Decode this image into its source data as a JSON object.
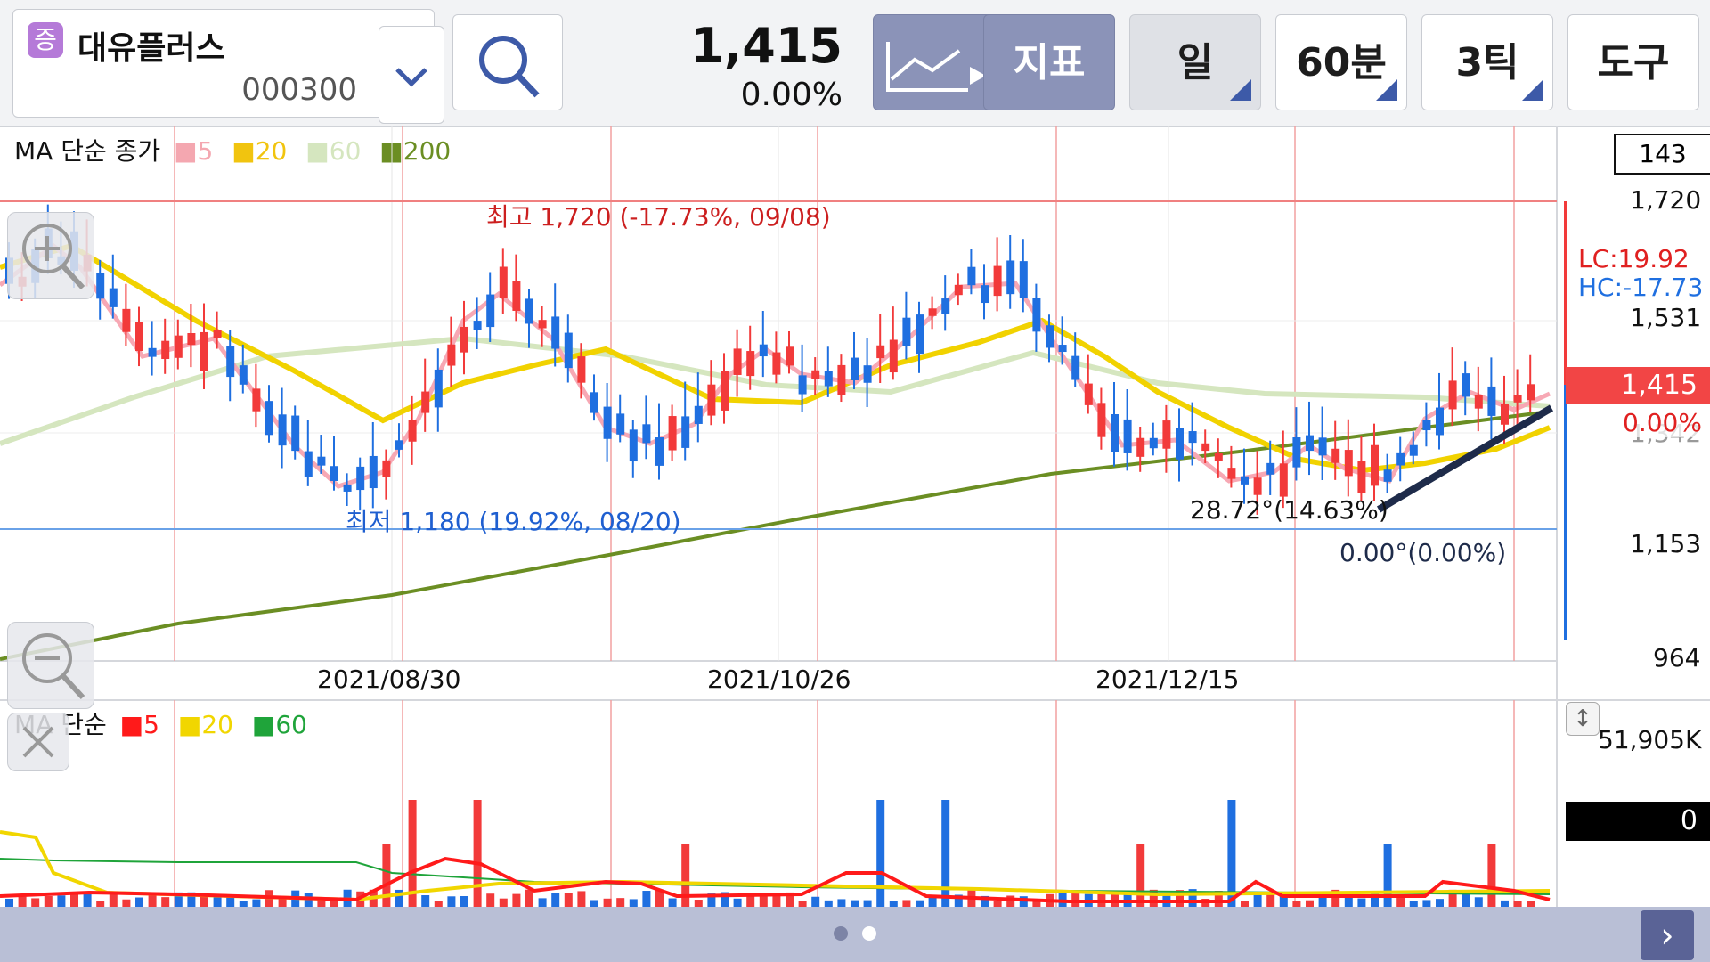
{
  "header": {
    "badge": "증",
    "stock_name": "대유플러스",
    "stock_code": "000300",
    "price": "1,415",
    "change_pct": "0.00%",
    "buttons": {
      "indicator": "지표",
      "daily": "일",
      "min60": "60분",
      "tick3": "3틱",
      "tools": "도구"
    }
  },
  "price_chart": {
    "legend_title": "MA 단순 종가",
    "ma": [
      {
        "label": "5",
        "color": "#f4a7b0"
      },
      {
        "label": "20",
        "color": "#f1c40f"
      },
      {
        "label": "60",
        "color": "#d5e6bf"
      },
      {
        "label": "200",
        "color": "#6b8e23"
      }
    ],
    "top_box": "143",
    "y_ticks": [
      "1,720",
      "1,531",
      "1,342",
      "1,153",
      "964"
    ],
    "x_ticks": [
      "2021/08/30",
      "2021/10/26",
      "2021/12/15"
    ],
    "high_label": "최고 1,720 (-17.73%, 09/08)",
    "low_label": "최저 1,180 (19.92%, 08/20)",
    "lc": "LC:19.92",
    "hc": "HC:-17.73",
    "current_price": "1,415",
    "current_pct": "0.00%",
    "trend_label1": "28.72°(14.63%)",
    "trend_label2": "0.00°(0.00%)",
    "colors": {
      "up": "#f23a3a",
      "down": "#1f6fe0"
    }
  },
  "volume_chart": {
    "legend_title": "MA 단순",
    "ma": [
      {
        "label": "5",
        "color": "#ff1a1a"
      },
      {
        "label": "20",
        "color": "#f1d600"
      },
      {
        "label": "60",
        "color": "#1fa43a"
      }
    ],
    "top_label": "51,905K",
    "current": "0"
  },
  "chart_data": {
    "type": "candlestick",
    "x_ticks": [
      "2021/08/30",
      "2021/10/26",
      "2021/12/15"
    ],
    "y_ticks": [
      1720,
      1531,
      1342,
      1153,
      964
    ],
    "high": {
      "value": 1720,
      "date": "09/08",
      "pct": -17.73
    },
    "low": {
      "value": 1180,
      "date": "08/20",
      "pct": 19.92
    },
    "last_price": 1415
  }
}
